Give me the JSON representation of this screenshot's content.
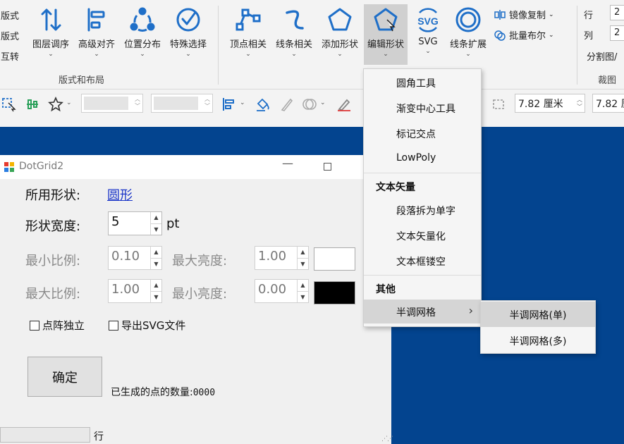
{
  "ribbon": {
    "left_labels": [
      "版式",
      "版式",
      "互转"
    ],
    "group1": {
      "label": "版式和布局",
      "buttons": [
        {
          "label": "图层调序",
          "icon": "layer-order-icon"
        },
        {
          "label": "高级对齐",
          "icon": "align-icon"
        },
        {
          "label": "位置分布",
          "icon": "distribute-icon"
        },
        {
          "label": "特殊选择",
          "icon": "select-check-icon"
        }
      ]
    },
    "group2": {
      "buttons": [
        {
          "label": "顶点相关",
          "icon": "vertex-icon"
        },
        {
          "label": "线条相关",
          "icon": "curve-icon"
        },
        {
          "label": "添加形状",
          "icon": "pentagon-icon"
        },
        {
          "label": "编辑形状",
          "icon": "edit-shape-icon"
        },
        {
          "label": "SVG",
          "icon": "svg-icon"
        },
        {
          "label": "线条扩展",
          "icon": "line-expand-icon"
        }
      ]
    },
    "small_buttons": [
      {
        "label": "镜像复制",
        "icon": "mirror-icon"
      },
      {
        "label": "批量布尔",
        "icon": "boolean-icon"
      }
    ],
    "grid": {
      "row_label": "行",
      "row_value": "2",
      "col_label": "列",
      "col_value": "2",
      "split_label": "分割图/",
      "group_label": "裁图"
    }
  },
  "toolbar": {
    "width_value": "7.82 厘米",
    "height_value": "7.82 厘"
  },
  "dialog": {
    "title": "DotGrid2",
    "shape_label": "所用形状:",
    "shape_value": "圆形",
    "width_label": "形状宽度:",
    "width_value": "5",
    "width_unit": "pt",
    "min_ratio_label": "最小比例:",
    "min_ratio_value": "0.10",
    "max_bright_label": "最大亮度:",
    "max_bright_value": "1.00",
    "max_ratio_label": "最大比例:",
    "max_ratio_value": "1.00",
    "min_bright_label": "最小亮度:",
    "min_bright_value": "0.00",
    "check_independent": "点阵独立",
    "check_export_svg": "导出SVG文件",
    "ok_label": "确定",
    "count_label": "已生成的点的数量:",
    "count_value": "0000",
    "status_row_label": "行",
    "colors": {
      "max_bright_swatch": "#ffffff",
      "min_bright_swatch": "#000000"
    }
  },
  "menu": {
    "items": [
      "圆角工具",
      "渐变中心工具",
      "标记交点",
      "LowPoly"
    ],
    "section_text": "文本矢量",
    "text_items": [
      "段落拆为单字",
      "文本矢量化",
      "文本框镂空"
    ],
    "section_other": "其他",
    "halftone": "半调网格",
    "submenu": [
      "半调网格(单)",
      "半调网格(多)"
    ]
  },
  "colors": {
    "slide_background": "#03448f",
    "accent_blue": "#1f6fc8",
    "menu_highlight": "#d5d5d5"
  }
}
